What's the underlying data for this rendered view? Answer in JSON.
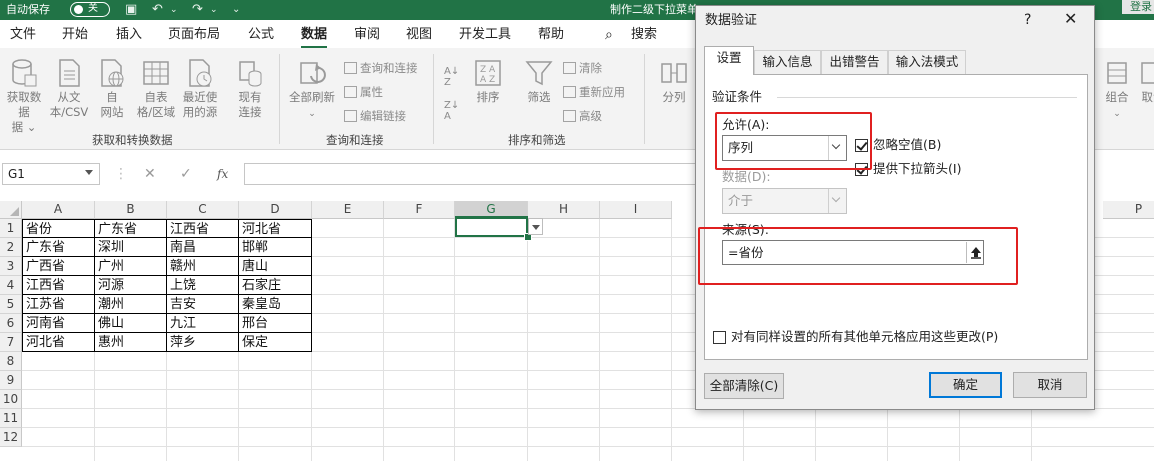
{
  "titlebar": {
    "autosave_label": "自动保存",
    "autosave_state": "关",
    "filename": "制作二级下拉菜单.xlsx",
    "login": "登录"
  },
  "menu": [
    "文件",
    "开始",
    "插入",
    "页面布局",
    "公式",
    "数据",
    "审阅",
    "视图",
    "开发工具",
    "帮助"
  ],
  "menu_active": "数据",
  "search_label": "搜索",
  "ribbon": {
    "get_data": "获取数据",
    "get_data2": "据 ⌄",
    "from_csv": "从文",
    "from_csv2": "本/CSV",
    "from_web": "自",
    "from_web2": "网站",
    "from_table": "自表",
    "from_table2": "格/区域",
    "recent": "最近使",
    "recent2": "用的源",
    "existing": "现有",
    "existing2": "连接",
    "group_get": "获取和转换数据",
    "refresh_all": "全部刷新",
    "queries": "查询和连接",
    "properties": "属性",
    "edit_links": "编辑链接",
    "group_queries": "查询和连接",
    "sort": "排序",
    "filter": "筛选",
    "clear": "清除",
    "reapply": "重新应用",
    "advanced": "高级",
    "group_sort": "排序和筛选",
    "split": "分列",
    "combine": "组合",
    "cancel_group": "取消"
  },
  "formula_bar": {
    "cell_ref": "G1",
    "fx": "fx",
    "value": ""
  },
  "columns": [
    "A",
    "B",
    "C",
    "D",
    "E",
    "F",
    "G",
    "H",
    "I",
    "P"
  ],
  "rows": [
    "1",
    "2",
    "3",
    "4",
    "5",
    "6",
    "7",
    "8",
    "9",
    "10",
    "11",
    "12"
  ],
  "table": [
    [
      "省份",
      "广东省",
      "江西省",
      "河北省"
    ],
    [
      "广东省",
      "深圳",
      "南昌",
      "邯郸"
    ],
    [
      "广西省",
      "广州",
      "赣州",
      "唐山"
    ],
    [
      "江西省",
      "河源",
      "上饶",
      "石家庄"
    ],
    [
      "江苏省",
      "潮州",
      "吉安",
      "秦皇岛"
    ],
    [
      "河南省",
      "佛山",
      "九江",
      "邢台"
    ],
    [
      "河北省",
      "惠州",
      "萍乡",
      "保定"
    ]
  ],
  "dialog": {
    "title": "数据验证",
    "help": "?",
    "close": "✕",
    "tabs": [
      "设置",
      "输入信息",
      "出错警告",
      "输入法模式"
    ],
    "section": "验证条件",
    "allow_label": "允许(A):",
    "allow_value": "序列",
    "ignore_blank": "忽略空值(B)",
    "dropdown": "提供下拉箭头(I)",
    "data_label": "数据(D):",
    "data_value": "介于",
    "source_label": "来源(S):",
    "source_value": "=省份",
    "apply_all": "对有同样设置的所有其他单元格应用这些更改(P)",
    "clear_all": "全部清除(C)",
    "ok": "确定",
    "cancel": "取消"
  }
}
